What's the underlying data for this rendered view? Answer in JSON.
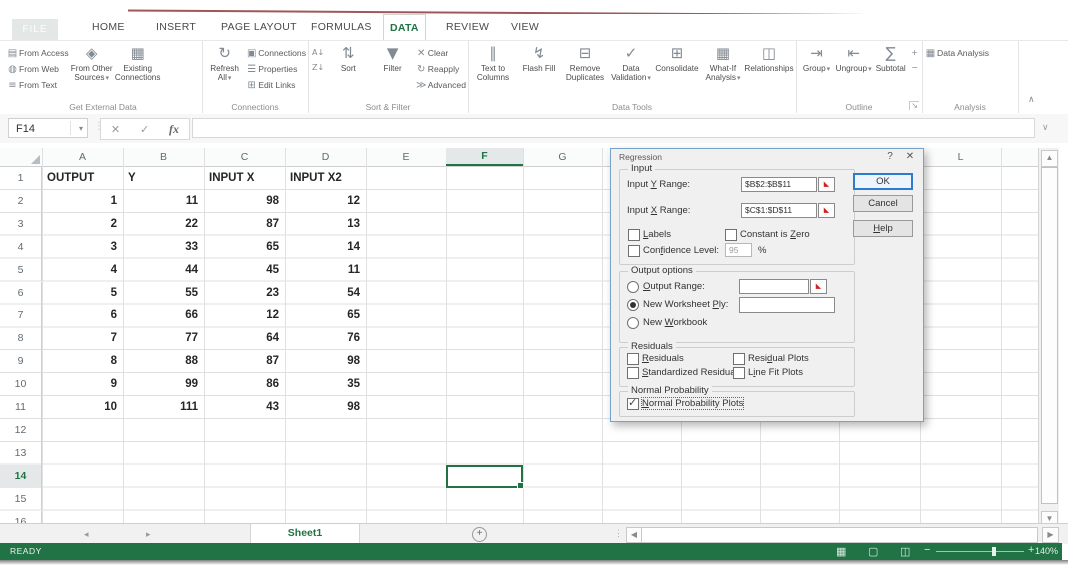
{
  "window": {
    "file_tab": "FILE"
  },
  "ribbon": {
    "tabs": [
      "HOME",
      "INSERT",
      "PAGE LAYOUT",
      "FORMULAS",
      "DATA",
      "REVIEW",
      "VIEW"
    ],
    "active_tab": "DATA",
    "groups": [
      {
        "label": "Get External Data",
        "buttons": [
          {
            "label": "From Access",
            "type": "small",
            "icon": "database-icon"
          },
          {
            "label": "From Web",
            "type": "small",
            "icon": "globe-icon"
          },
          {
            "label": "From Text",
            "type": "small",
            "icon": "text-file-icon"
          },
          {
            "label": "From Other Sources",
            "type": "large",
            "icon": "other-sources-icon",
            "arrow": true
          },
          {
            "label": "Existing Connections",
            "type": "large",
            "icon": "existing-connections-icon"
          }
        ]
      },
      {
        "label": "Connections",
        "buttons": [
          {
            "label": "Refresh All",
            "type": "large",
            "icon": "refresh-icon",
            "arrow": true
          },
          {
            "label": "Connections",
            "type": "small",
            "icon": "connections-icon"
          },
          {
            "label": "Properties",
            "type": "small",
            "icon": "properties-icon"
          },
          {
            "label": "Edit Links",
            "type": "small",
            "icon": "edit-links-icon"
          }
        ]
      },
      {
        "label": "Sort & Filter",
        "buttons": [
          {
            "label": "",
            "type": "tiny",
            "icon": "sort-az-icon"
          },
          {
            "label": "",
            "type": "tiny",
            "icon": "sort-za-icon"
          },
          {
            "label": "Sort",
            "type": "large",
            "icon": "sort-icon"
          },
          {
            "label": "Filter",
            "type": "large",
            "icon": "filter-icon"
          },
          {
            "label": "Clear",
            "type": "small",
            "icon": "clear-icon"
          },
          {
            "label": "Reapply",
            "type": "small",
            "icon": "reapply-icon"
          },
          {
            "label": "Advanced",
            "type": "small",
            "icon": "advanced-icon"
          }
        ]
      },
      {
        "label": "Data Tools",
        "buttons": [
          {
            "label": "Text to Columns",
            "type": "large",
            "icon": "text-to-columns-icon"
          },
          {
            "label": "Flash Fill",
            "type": "large",
            "icon": "flash-fill-icon"
          },
          {
            "label": "Remove Duplicates",
            "type": "large",
            "icon": "remove-duplicates-icon"
          },
          {
            "label": "Data Validation",
            "type": "large",
            "icon": "data-validation-icon",
            "arrow": true
          },
          {
            "label": "Consolidate",
            "type": "large",
            "icon": "consolidate-icon"
          },
          {
            "label": "What-If Analysis",
            "type": "large",
            "icon": "what-if-analysis-icon",
            "arrow": true
          },
          {
            "label": "Relationships",
            "type": "large",
            "icon": "relationships-icon"
          }
        ]
      },
      {
        "label": "Outline",
        "launcher": true,
        "buttons": [
          {
            "label": "Group",
            "type": "large",
            "icon": "group-icon",
            "arrow": true
          },
          {
            "label": "Ungroup",
            "type": "large",
            "icon": "ungroup-icon",
            "arrow": true
          },
          {
            "label": "Subtotal",
            "type": "large",
            "icon": "subtotal-icon"
          },
          {
            "label": "",
            "type": "tiny",
            "icon": "show-detail-icon"
          },
          {
            "label": "",
            "type": "tiny",
            "icon": "hide-detail-icon"
          }
        ]
      },
      {
        "label": "Analysis",
        "buttons": [
          {
            "label": "Data Analysis",
            "type": "small",
            "icon": "data-analysis-icon"
          }
        ]
      }
    ]
  },
  "formula_bar": {
    "name_box": "F14",
    "formula": ""
  },
  "grid": {
    "columns": [
      "A",
      "B",
      "C",
      "D",
      "E",
      "F",
      "G",
      "H",
      "I",
      "J",
      "K",
      "L"
    ],
    "row_count": 16,
    "selected_cell": "F14",
    "selected_column": "F",
    "selected_row": "14"
  },
  "sheet": {
    "rows": [
      [
        "OUTPUT",
        "Y",
        "INPUT X",
        "INPUT X2"
      ],
      [
        "1",
        "11",
        "98",
        "12"
      ],
      [
        "2",
        "22",
        "87",
        "13"
      ],
      [
        "3",
        "33",
        "65",
        "14"
      ],
      [
        "4",
        "44",
        "45",
        "11"
      ],
      [
        "5",
        "55",
        "23",
        "54"
      ],
      [
        "6",
        "66",
        "12",
        "65"
      ],
      [
        "7",
        "77",
        "64",
        "76"
      ],
      [
        "8",
        "88",
        "87",
        "98"
      ],
      [
        "9",
        "99",
        "86",
        "35"
      ],
      [
        "10",
        "111",
        "43",
        "98"
      ]
    ]
  },
  "dialog": {
    "title": "Regression",
    "help_icon": "?",
    "close_icon": "✕",
    "input_group": {
      "label": "Input",
      "y_range_label": "Input Y Range:",
      "y_range_value": "$B$2:$B$11",
      "x_range_label": "Input X Range:",
      "x_range_value": "$C$1:$D$11",
      "labels_checkbox": "Labels",
      "constant_zero_checkbox": "Constant is Zero",
      "confidence_checkbox": "Confidence Level:",
      "confidence_value": "95",
      "confidence_unit": "%"
    },
    "buttons": {
      "ok": "OK",
      "cancel": "Cancel",
      "help": "Help"
    },
    "output_group": {
      "label": "Output options",
      "output_range": "Output Range:",
      "output_range_value": "",
      "new_worksheet": "New Worksheet Ply:",
      "new_worksheet_value": "",
      "new_workbook": "New Workbook",
      "selected": "new_worksheet"
    },
    "residuals_group": {
      "label": "Residuals",
      "residuals": "Residuals",
      "standardized": "Standardized Residuals",
      "residual_plots": "Residual Plots",
      "line_fit": "Line Fit Plots"
    },
    "normal_group": {
      "label": "Normal Probability",
      "normal_plots": "Normal Probability Plots",
      "checked": true
    },
    "accels": {
      "y_range": "Y",
      "x_range": "X",
      "labels": "L",
      "zero": "Z",
      "confidence": "f",
      "output_range": "O",
      "ply": "P",
      "workbook": "W",
      "residuals": "R",
      "residual_plots": "d",
      "standardized": "S",
      "line_fit": "i",
      "normal": "N",
      "help": "H"
    }
  },
  "sheet_tabs": {
    "active": "Sheet1",
    "add_icon": "+"
  },
  "status_bar": {
    "ready": "READY",
    "zoom": "140%"
  }
}
